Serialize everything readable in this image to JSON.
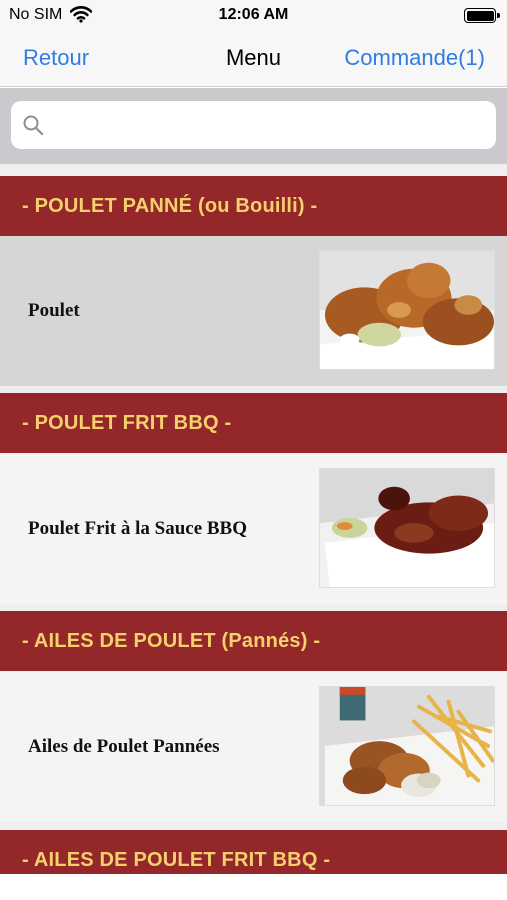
{
  "status_bar": {
    "carrier": "No SIM",
    "time": "12:06 AM"
  },
  "nav": {
    "back_label": "Retour",
    "title": "Menu",
    "order_label": "Commande(1)"
  },
  "search": {
    "placeholder": "",
    "value": ""
  },
  "sections": [
    {
      "title": "- POULET PANNÉ (ou Bouilli) -",
      "items": [
        {
          "label": "Poulet",
          "selected": true,
          "image": "fried-chicken-photo"
        }
      ]
    },
    {
      "title": "- POULET FRIT BBQ -",
      "items": [
        {
          "label": "Poulet Frit à la Sauce BBQ",
          "selected": false,
          "image": "bbq-chicken-photo"
        }
      ]
    },
    {
      "title": "- AILES DE POULET (Pannés) -",
      "items": [
        {
          "label": "Ailes de Poulet Pannées",
          "selected": false,
          "image": "chicken-wings-fries-photo"
        }
      ]
    },
    {
      "title": "- AILES DE POULET FRIT BBQ -",
      "items": []
    }
  ],
  "colors": {
    "accent": "#2f7de1",
    "section_bg": "#932729",
    "section_text": "#f5d06d",
    "selected_row": "#d6d6d6"
  },
  "icons": {
    "search": "search-icon",
    "wifi": "wifi-icon",
    "battery": "battery-icon"
  }
}
